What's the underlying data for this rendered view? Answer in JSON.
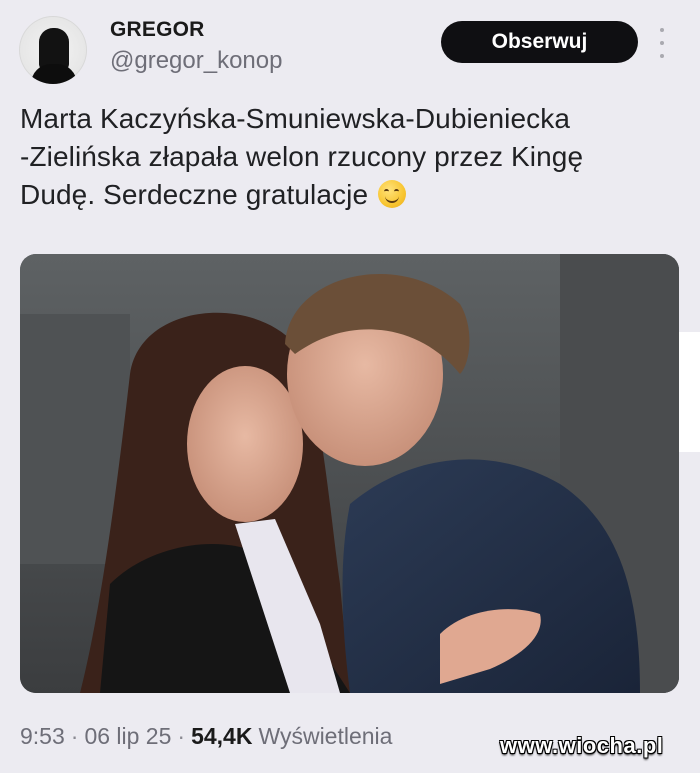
{
  "header": {
    "display_name": "GREGOR",
    "handle": "@gregor_konop",
    "follow_label": "Obserwuj"
  },
  "tweet": {
    "text": "Marta Kaczyńska-Smuniewska-Dubieniecka\n-Zielińska złapała welon rzucony przez Kingę\nDudę. Serdeczne gratulacje",
    "emoji": "smiling-face-icon"
  },
  "meta": {
    "time": "9:53",
    "date": "06 lip 25",
    "views": "54,4K",
    "views_label": "Wyświetlenia",
    "separator": "·"
  },
  "watermark": {
    "text": "www.wiocha.pl"
  },
  "colors": {
    "background": "#ecebf1",
    "button": "#0f0f12",
    "secondary_text": "#6e6e78"
  }
}
